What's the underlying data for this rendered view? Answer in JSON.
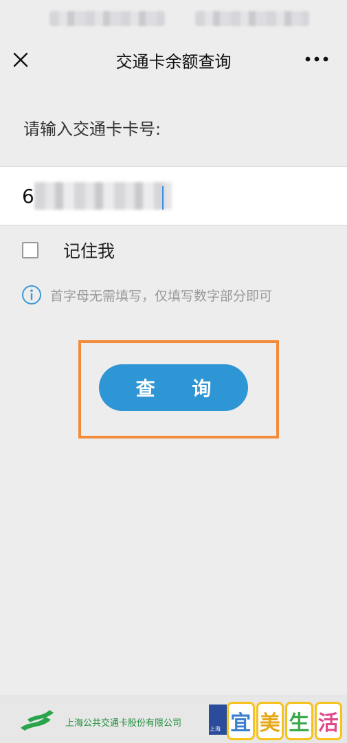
{
  "nav": {
    "title": "交通卡余额查询"
  },
  "form": {
    "prompt": "请输入交通卡卡号:",
    "card_number_visible": "6",
    "remember_label": "记住我",
    "remember_checked": false,
    "hint": "首字母无需填写，仅填写数字部分即可",
    "submit_label": "查 询"
  },
  "footer": {
    "company": "上海公共交通卡股份有限公司",
    "partner_text": "上海",
    "watermark_chars": [
      "宜",
      "美",
      "生",
      "活"
    ]
  },
  "colors": {
    "accent": "#2f96d6",
    "highlight": "#f28c3a",
    "brand_green": "#1f8e3c",
    "watermark_border": "#f6c21b"
  },
  "icons": [
    "close-icon",
    "more-icon",
    "info-icon",
    "checkbox-icon",
    "brand-logo"
  ]
}
